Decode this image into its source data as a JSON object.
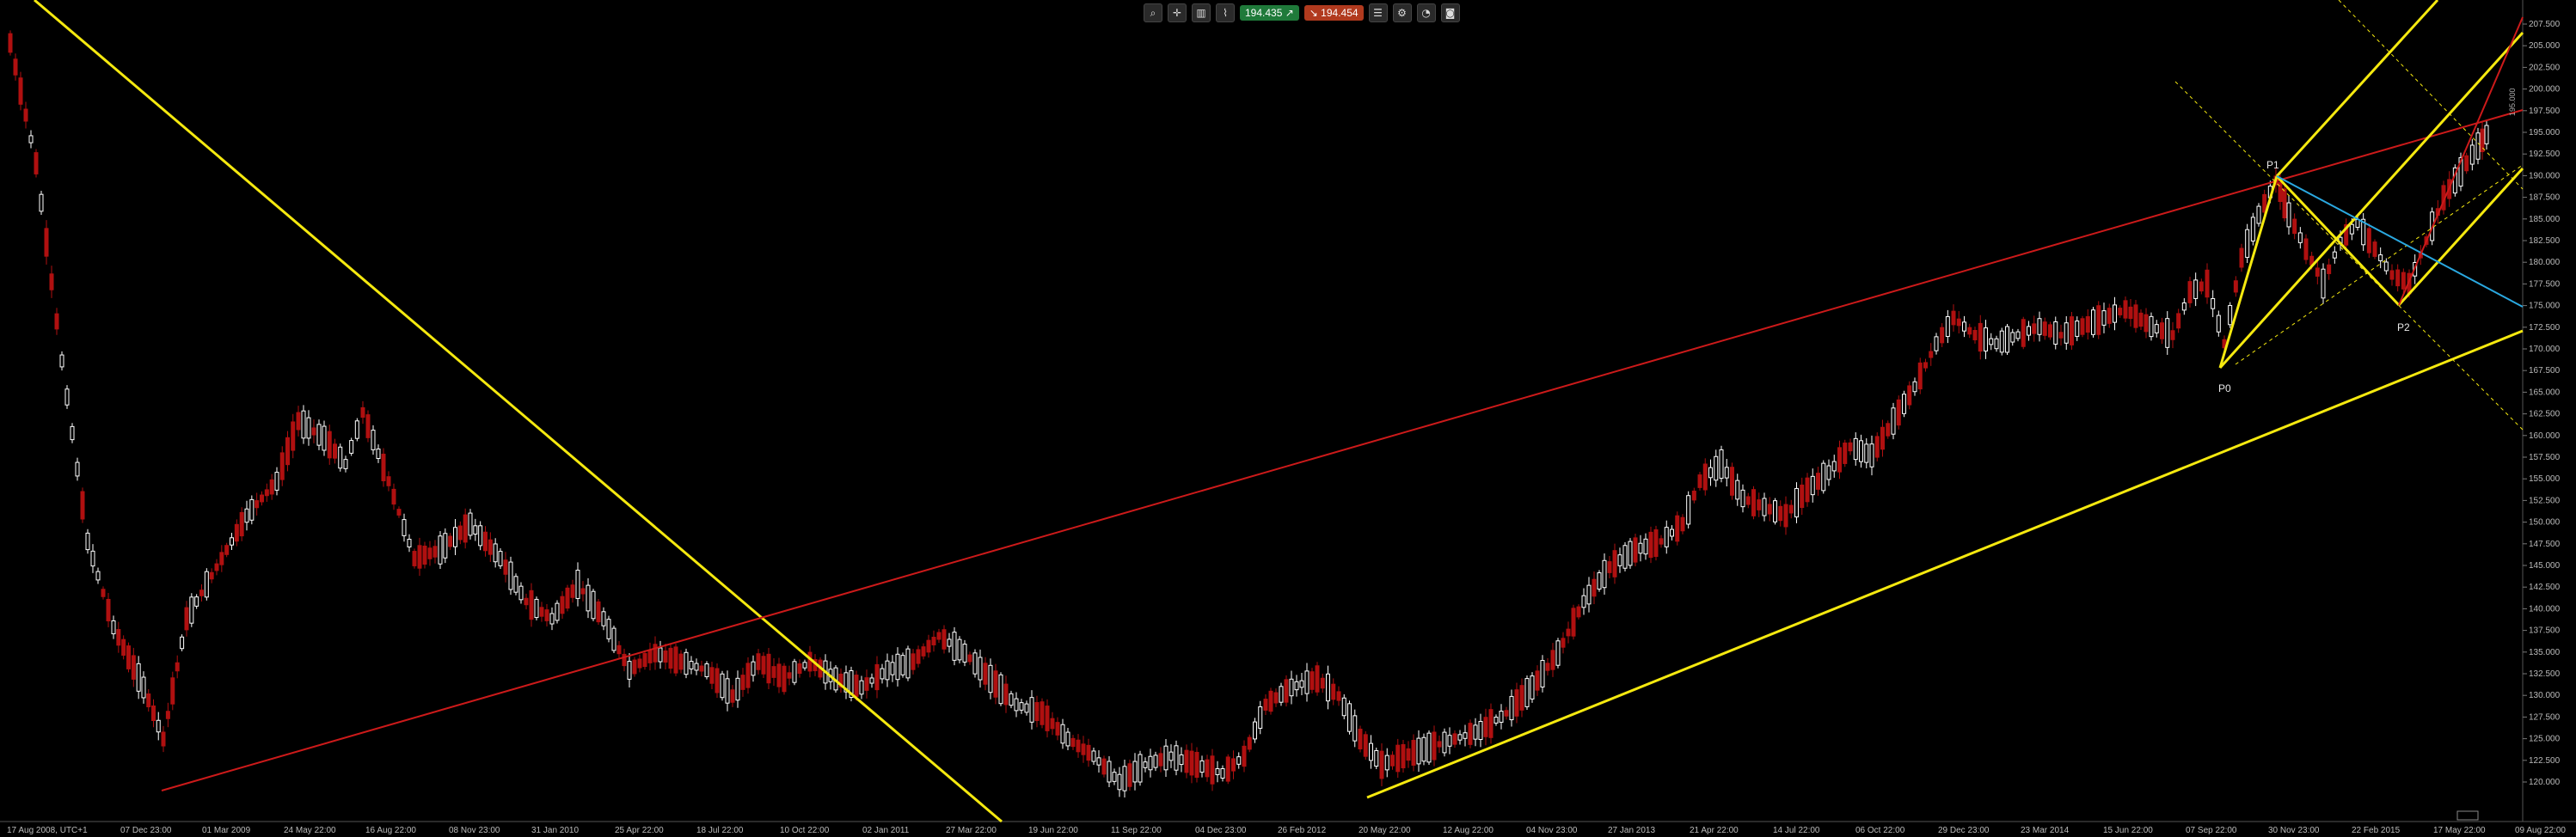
{
  "toolbar": {
    "icons": [
      "zoom-icon",
      "crosshair-icon",
      "bar-type-icon",
      "indicator-icon",
      "one-click-icon",
      "layout-icon",
      "settings-icon",
      "alarm-icon"
    ],
    "bid": "194.435",
    "ask": "194.454"
  },
  "x_axis": {
    "labels": [
      "17 Aug 2008, UTC+1",
      "07 Dec 23:00",
      "01 Mar 2009",
      "24 May 22:00",
      "16 Aug 22:00",
      "08 Nov 23:00",
      "31 Jan 2010",
      "25 Apr 22:00",
      "18 Jul 22:00",
      "10 Oct 22:00",
      "02 Jan 2011",
      "27 Mar 22:00",
      "19 Jun 22:00",
      "11 Sep 22:00",
      "04 Dec 23:00",
      "26 Feb 2012",
      "20 May 22:00",
      "12 Aug 22:00",
      "04 Nov 23:00",
      "27 Jan 2013",
      "21 Apr 22:00",
      "14 Jul 22:00",
      "06 Oct 22:00",
      "29 Dec 23:00",
      "23 Mar 2014",
      "15 Jun 22:00",
      "07 Sep 22:00",
      "30 Nov 23:00",
      "22 Feb 2015",
      "17 May 22:00",
      "09 Aug 22:00"
    ]
  },
  "y_axis": {
    "labels": [
      "207.500",
      "205.000",
      "202.500",
      "200.000",
      "197.500",
      "195.000",
      "192.500",
      "190.000",
      "187.500",
      "185.000",
      "182.500",
      "180.000",
      "177.500",
      "175.000",
      "172.500",
      "170.000",
      "167.500",
      "165.000",
      "162.500",
      "160.000",
      "157.500",
      "155.000",
      "152.500",
      "150.000",
      "147.500",
      "145.000",
      "142.500",
      "140.000",
      "137.500",
      "135.000",
      "132.500",
      "130.000",
      "127.500",
      "125.000",
      "122.500",
      "120.000"
    ]
  },
  "pitchfork_labels": {
    "p0": "P0",
    "p1": "P1",
    "p2": "P2"
  },
  "axis_tag": "195.000",
  "colors": {
    "background": "#000000",
    "bull_candle": "#ffffff",
    "bear_candle": "#b01010",
    "trendline": "#f5e90f",
    "red_line": "#cc1a1a",
    "blue_line": "#2aa8e0"
  }
}
